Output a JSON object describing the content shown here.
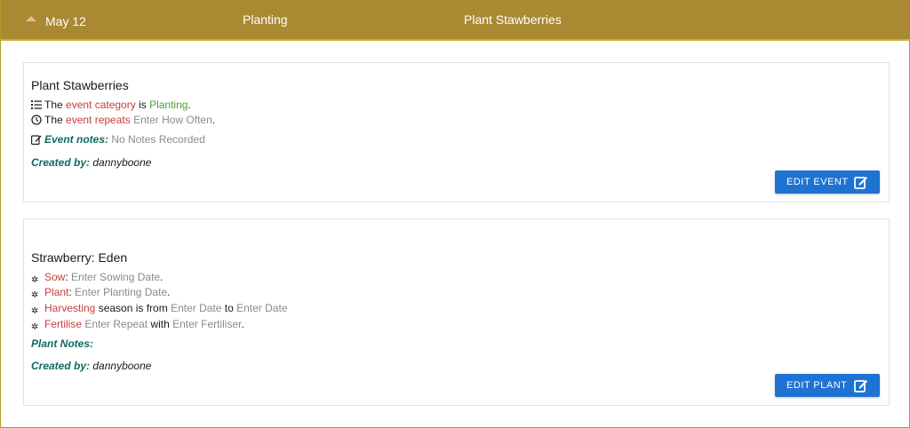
{
  "header": {
    "date": "May 12",
    "category": "Planting",
    "title": "Plant Stawberries"
  },
  "event_card": {
    "title": "Plant Stawberries",
    "category_line": {
      "prefix": "The ",
      "key": "event category",
      "mid": " is ",
      "value": "Planting",
      "suffix": "."
    },
    "repeat_line": {
      "prefix": "The ",
      "key": "event repeats",
      "value": "Enter How Often",
      "suffix": "."
    },
    "notes": {
      "label": "Event notes:",
      "value": "No Notes Recorded"
    },
    "created": {
      "label": "Created by:",
      "value": "dannyboone"
    },
    "button_label": "EDIT EVENT"
  },
  "plant_card": {
    "title": "Strawberry: Eden",
    "sow": {
      "key": "Sow",
      "sep": ":",
      "value": "Enter Sowing Date",
      "suffix": "."
    },
    "plant": {
      "key": "Plant",
      "sep": ":",
      "value": "Enter Planting Date",
      "suffix": "."
    },
    "harvest": {
      "key": "Harvesting",
      "mid": " season is from ",
      "from": "Enter Date",
      "to_word": " to ",
      "to": "Enter Date"
    },
    "fertilise": {
      "key": "Fertilise",
      "value": "Enter Repeat",
      "with_word": " with ",
      "with": "Enter Fertiliser",
      "suffix": "."
    },
    "notes_label": "Plant Notes:",
    "created": {
      "label": "Created by:",
      "value": "dannyboone"
    },
    "button_label": "EDIT PLANT"
  },
  "colors": {
    "header_bg": "#a98a33",
    "key_red": "#c4413a",
    "value_green": "#4c9e2f",
    "label_teal": "#0f6b5e",
    "button_blue": "#1e73d2"
  },
  "icons": [
    "caret-up-icon",
    "list-icon",
    "clock-icon",
    "edit-note-icon",
    "gear-icon",
    "edit-icon"
  ]
}
